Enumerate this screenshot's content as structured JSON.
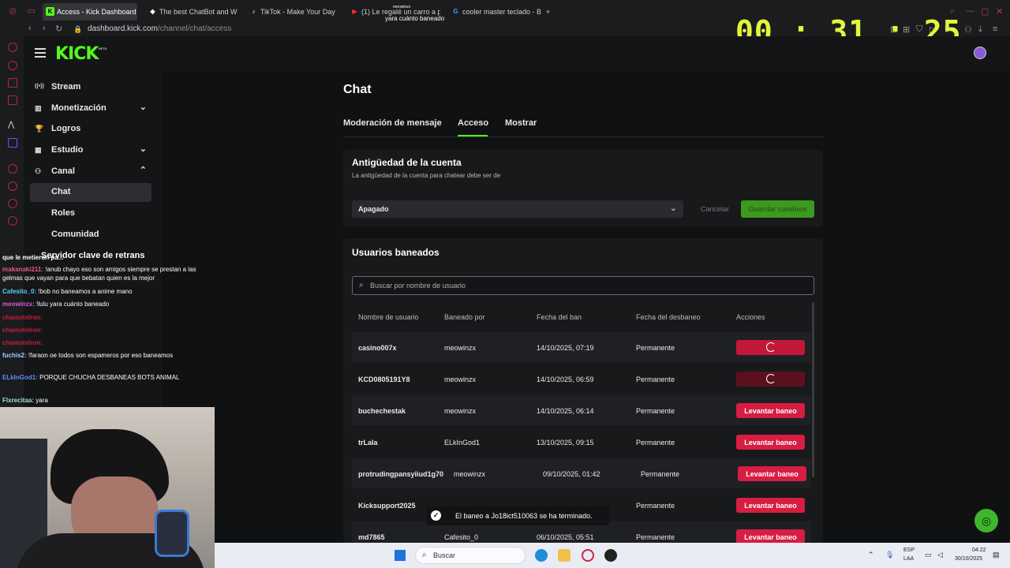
{
  "browser": {
    "tabs": [
      {
        "label": "Access - Kick Dashboard",
        "favicon": "K",
        "active": true
      },
      {
        "label": "The best ChatBot and W",
        "favicon": "◆",
        "active": false
      },
      {
        "label": "TikTok - Make Your Day",
        "favicon": "♪",
        "active": false
      },
      {
        "label": "(1) Le regalé un carro a p",
        "favicon": "▶",
        "active": false
      },
      {
        "label": "cooler master teclado - B",
        "favicon": "G",
        "active": false
      }
    ],
    "new_tab": "+",
    "url_host": "dashboard.kick.com",
    "url_path": "/channel/chat/access"
  },
  "overlay": {
    "timer": "00 : 31 : 25",
    "top_user": "meowinzx",
    "top_message": "yara cuánto baneado",
    "chat_title": "Servidor clave de retrans",
    "chat": [
      {
        "name": "que le metieron pa... ",
        "text": "",
        "color": "#ffffff"
      },
      {
        "name": "makanaki211:",
        "text": "!anub chayo eso son amigos siempre se prestan a las gelmas que vayan para que bebatan quien es la mejor",
        "color": "#e05a8a"
      },
      {
        "name": "Cafesito_0:",
        "text": "!bob no baneamos a anime mano",
        "color": "#5ad1ff"
      },
      {
        "name": "meowinzx:",
        "text": "!lulu yara cuánto baneado",
        "color": "#d65ad6"
      },
      {
        "name": "chamotelron:",
        "text": "",
        "color": "#c0213a"
      },
      {
        "name": "chamotelron:",
        "text": "",
        "color": "#c0213a"
      },
      {
        "name": "chamotelron:",
        "text": "",
        "color": "#c0213a"
      },
      {
        "name": "fuchis2:",
        "text": "!faraon oe todos son espameros por eso baneamos",
        "color": "#9ad0ff"
      },
      {
        "name": "ELkInGod1:",
        "text": "PORQUE CHUCHA DESBANEAS BOTS ANIMAL",
        "color": "#5a8cff"
      },
      {
        "name": "Flxrecitaa:",
        "text": "yara",
        "color": "#9ae0d0"
      }
    ]
  },
  "kick": {
    "logo": "KICK",
    "logo_badge": "BETA"
  },
  "sidebar": {
    "items": [
      {
        "label": "Stream",
        "icon": "((•))",
        "chevron": ""
      },
      {
        "label": "Monetización",
        "icon": "▥",
        "chevron": "⌄"
      },
      {
        "label": "Logros",
        "icon": "🏆",
        "chevron": ""
      },
      {
        "label": "Estudio",
        "icon": "▦",
        "chevron": "⌄"
      },
      {
        "label": "Canal",
        "icon": "⚇",
        "chevron": "⌃"
      }
    ],
    "subitems": [
      {
        "label": "Chat",
        "selected": true
      },
      {
        "label": "Roles",
        "selected": false
      },
      {
        "label": "Comunidad",
        "selected": false
      }
    ]
  },
  "page": {
    "title": "Chat",
    "tabs": [
      "Moderación de mensaje",
      "Acceso",
      "Mostrar"
    ],
    "active_tab": "Acceso"
  },
  "account_age": {
    "title": "Antigüedad de la cuenta",
    "subtitle": "La antigüedad de la cuenta para chatear debe ser de",
    "selected": "Apagado",
    "cancel": "Cancelar",
    "save": "Guardar cambios"
  },
  "banned": {
    "title": "Usuarios baneados",
    "search_placeholder": "Buscar por nombre de usuario",
    "columns": [
      "Nombre de usuario",
      "Baneado por",
      "Fecha del ban",
      "Fecha del desbaneo",
      "Acciones"
    ],
    "rows": [
      {
        "user": "casino007x",
        "by": "meowinzx",
        "date": "14/10/2025, 07:19",
        "unban_date": "Permanente",
        "action": "",
        "state": "loading"
      },
      {
        "user": "KCD0805191Y8",
        "by": "meowinzx",
        "date": "14/10/2025, 06:59",
        "unban_date": "Permanente",
        "action": "",
        "state": "loading2"
      },
      {
        "user": "buchechestak",
        "by": "meowinzx",
        "date": "14/10/2025, 06:14",
        "unban_date": "Permanente",
        "action": "Levantar baneo",
        "state": "normal"
      },
      {
        "user": "trLaIa",
        "by": "ELkInGod1",
        "date": "13/10/2025, 09:15",
        "unban_date": "Permanente",
        "action": "Levantar baneo",
        "state": "normal"
      },
      {
        "user": "protrudingpansyiiud1g70",
        "by": "meowinzx",
        "date": "09/10/2025, 01:42",
        "unban_date": "Permanente",
        "action": "Levantar baneo",
        "state": "normal"
      },
      {
        "user": "Kicksupport2025",
        "by": "",
        "date": "",
        "unban_date": "Permanente",
        "action": "Levantar baneo",
        "state": "normal"
      },
      {
        "user": "md7865",
        "by": "Cafesito_0",
        "date": "06/10/2025, 05:51",
        "unban_date": "Permanente",
        "action": "Levantar baneo",
        "state": "normal"
      }
    ]
  },
  "toast": {
    "message": "El baneo a Jo18ict510063 se ha terminado."
  },
  "taskbar": {
    "search": "Buscar",
    "lang1": "ESP",
    "lang2": "LAA",
    "time": "04:22",
    "date": "30/10/2025"
  },
  "colors": {
    "accent": "#53fc18",
    "danger": "#d61d42",
    "timer": "#e3f53c"
  }
}
